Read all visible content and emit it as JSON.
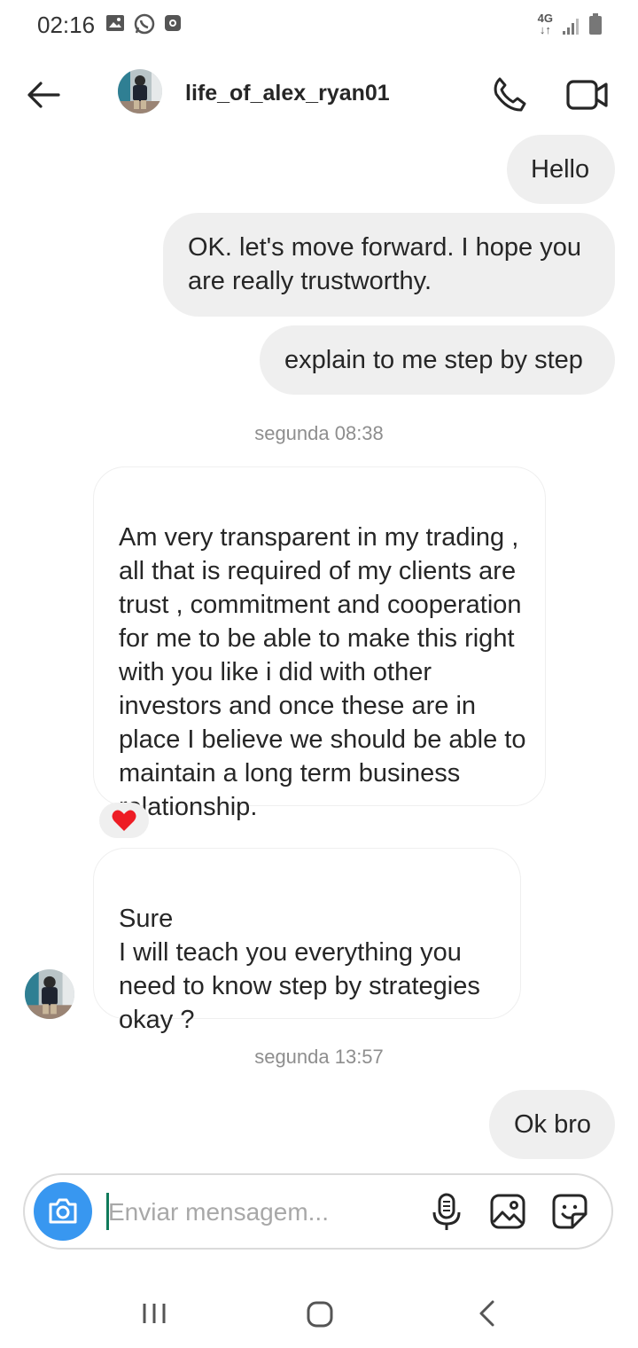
{
  "status_bar": {
    "time": "02:16",
    "network": "4G",
    "left_icons": [
      "image-icon",
      "whatsapp-icon",
      "record-icon"
    ],
    "right_icons": [
      "network-4g-icon",
      "signal-icon",
      "battery-icon"
    ]
  },
  "header": {
    "username": "life_of_alex_ryan01",
    "back_icon": "arrow-left-icon",
    "call_icon": "phone-icon",
    "video_icon": "video-camera-icon"
  },
  "messages": [
    {
      "text": "Hello",
      "direction": "outgoing"
    },
    {
      "text": "OK. let's move forward. I hope you are really trustworthy.",
      "direction": "outgoing"
    },
    {
      "text": "explain to me step by step",
      "direction": "outgoing"
    },
    {
      "text": "Am very transparent in my trading , all that is required of my clients are trust , commitment and cooperation for me to be able to make this right with you like i did  with other investors and once these are in place I believe we should be able to  maintain a long term business relationship.",
      "direction": "incoming",
      "reaction": "❤️"
    },
    {
      "text": "Sure\nI will teach you everything you need to know step by strategies okay ?",
      "direction": "incoming"
    },
    {
      "text": "Ok bro",
      "direction": "outgoing"
    }
  ],
  "timestamps": [
    "segunda 08:38",
    "segunda 13:57"
  ],
  "composer": {
    "placeholder": "Enviar mensagem...",
    "value": "",
    "icons": [
      "camera-icon",
      "microphone-icon",
      "gallery-icon",
      "sticker-icon"
    ]
  },
  "colors": {
    "accent": "#3897f0",
    "bubble_out": "#efefef",
    "timestamp": "#8e8e8e",
    "heart": "#ed1c24"
  }
}
